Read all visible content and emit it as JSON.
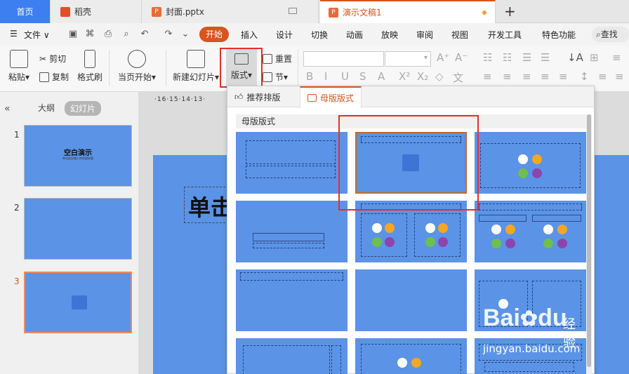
{
  "tabs": {
    "home": "首页",
    "daoke": "稻壳",
    "file": "封面.pptx",
    "active": "演示文稿1",
    "add": "+"
  },
  "menu": {
    "file": "文件",
    "items": [
      "开始",
      "插入",
      "设计",
      "切换",
      "动画",
      "放映",
      "审阅",
      "视图",
      "开发工具",
      "特色功能"
    ],
    "search": "查找"
  },
  "ribbon": {
    "paste": "粘贴",
    "cut": "剪切",
    "copy": "复制",
    "format_painter": "格式刷",
    "play_from_current": "当页开始",
    "new_slide": "新建幻灯片",
    "layout": "版式",
    "reset": "重置",
    "section": "节"
  },
  "left_panel": {
    "tab_outline": "大纲",
    "tab_slides": "幻灯片",
    "slides": [
      {
        "num": "1",
        "title": "空白演示",
        "subtitle": "单击此处输入你的副标题"
      },
      {
        "num": "2"
      },
      {
        "num": "3"
      }
    ]
  },
  "canvas": {
    "ruler": "·16·15·14·13·",
    "title_text": "单击"
  },
  "dropdown": {
    "tab_recommended": "推荐排版",
    "tab_master": "母版版式",
    "section_label": "母版版式"
  },
  "watermark": {
    "logo": "Bai",
    "logo_tail": "du",
    "jingyan": "经验",
    "url": "jingyan.baidu.com"
  },
  "colors": {
    "accent": "#d9541e",
    "slide_blue": "#5b93e6",
    "highlight_red": "#e03030"
  }
}
